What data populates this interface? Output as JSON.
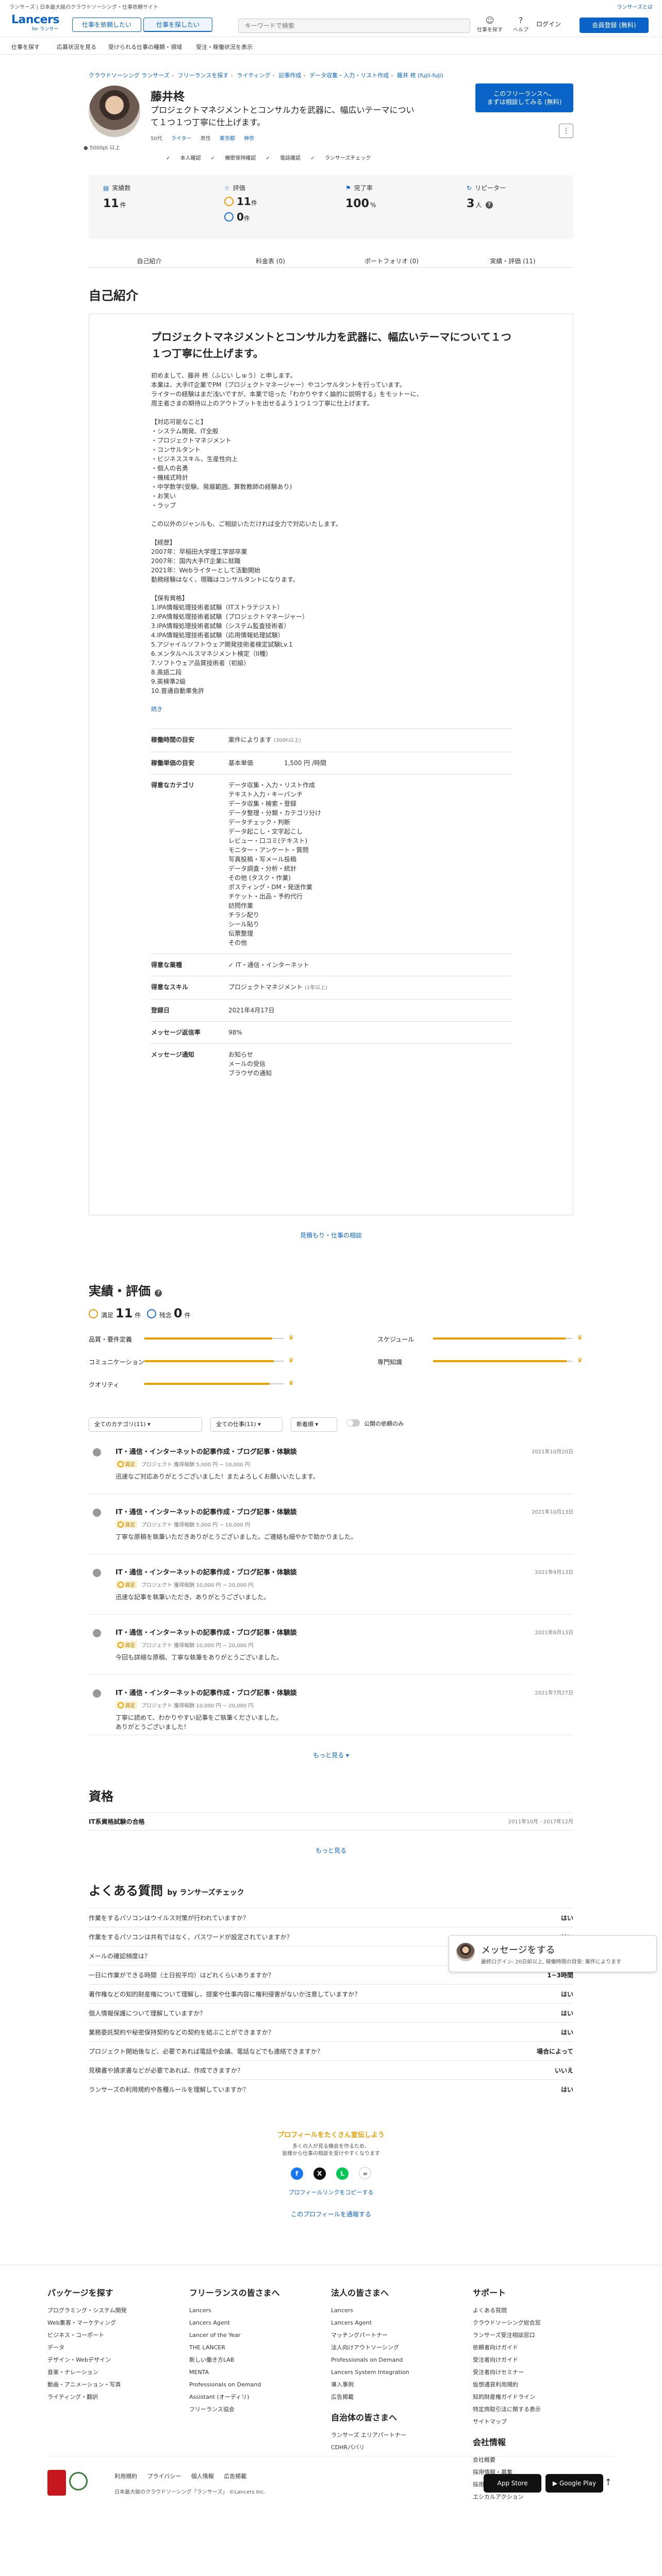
{
  "topbar": {
    "left": "ランサーズ | 日本最大級のクラウドソーシング・仕事依頼サイト",
    "right": "ランサーズとは"
  },
  "header": {
    "brand": "Lancers",
    "brand_sub": "for ランサー",
    "btn_request": "仕事を依頼したい",
    "btn_find": "仕事を探したい",
    "search_placeholder": "キーワードで検索",
    "icon_find": "仕事を探す",
    "icon_help": "ヘルプ",
    "login": "ログイン",
    "signup": "会員登録 (無料)"
  },
  "subnav": [
    "仕事を探す",
    "応募状況を見る",
    "受けられる仕事の種類・領域",
    "受注・稼働状況を表示"
  ],
  "breadcrumb": [
    "クラウドソーシング ランサーズ",
    "フリーランスを探す",
    "ライティング",
    "記事作成",
    "データ収集・入力・リスト作成",
    "藤井 柊 (fujii-fuji)"
  ],
  "profile": {
    "name": "藤井柊",
    "catch": "プロジェクトマネジメントとコンサル力を武器に、幅広いテーマについて１つ１つ丁寧に仕上げます。",
    "meta": [
      "50代",
      "ライター",
      "男性",
      "東京都",
      "神奈"
    ],
    "points": "● 5000pt 以上",
    "badges": [
      "本人確認",
      "機密保持確認",
      "電話確認",
      "ランサーズチェック"
    ],
    "consult": "このフリーランスへ、\nまずは相談してみる (無料)"
  },
  "stats": {
    "achievement_label": "実績数",
    "achievement": "11",
    "unit_ken": "件",
    "rating_label": "評価",
    "good": "11",
    "bad": "0",
    "completion_label": "完了率",
    "completion": "100",
    "unit_pct": "%",
    "repeat_label": "リピーター",
    "repeat": "3",
    "unit_nin": "人"
  },
  "tabs": [
    "自己紹介",
    "料金表 (0)",
    "ポートフォリオ (0)",
    "実績・評価 (11)"
  ],
  "intro": {
    "section": "自己紹介",
    "title": "プロジェクトマネジメントとコンサル力を武器に、幅広いテーマについて１つ１つ丁寧に仕上げます。",
    "body": "初めまして、藤井 柊（ふじい しゅう）と申します。\n本業は、大手IT企業でPM（プロジェクトマネージャー）やコンサルタントを行っています。\nライターの経験はまだ浅いですが、本業で培った「わかりやすく論的に説明する」をモットーに、\n周主者さまの期待以上のアウトプットを出せるよう１つ１つ丁寧に仕上げます。\n\n【対応可能なこと】\n・システム開発、IT全般\n・プロジェクトマネジメント\n・コンサルタント\n・ビジネススキル、生産性向上\n・個人の名勇\n・機械式時計\n・中学数学(受験、発展範囲、算数教師の経験あり)\n・お笑い\n・ラップ\n\nこの以外のジャンルも、ご相談いただければ全力で対応いたします。\n\n【経歴】\n2007年：早稲田大学理工学部卒業\n2007年：国内大手IT企業に就職\n2021年：Webライターとして活動開始\n勤務経験はなく、現職はコンサルタントになります。\n\n【保有資格】\n1.IPA情報処理技術者試験（ITストラテジスト）\n2.IPA情報処理技術者試験（プロジェクトマネージャー）\n3.IPA情報処理技術者試験（システム監査技術者）\n4.IPA情報処理技術者試験（応用情報処理試験）\n5.アジャイルソフトウェア開発技術者検定試験Lv.1\n6.メンタルヘルスマネジメント検定（II種）\n7.ソフトウェア品質技術者（初級）\n8.英語二段\n9.英検準2級\n10.普通自動車免許",
    "more": "続き",
    "rows": [
      {
        "k": "稼働時間の目安",
        "v": "案件によります",
        "note": "(300h以上)"
      },
      {
        "k": "稼働単価の目安",
        "v": "基本単価",
        "num": "1,500 円 /時間"
      },
      {
        "k": "得意なカテゴリ",
        "list": [
          "データ収集・入力・リスト作成",
          "テキスト入力・キーパンチ",
          "データ収集・検索・登録",
          "データ整理・分類・カテゴリ分け",
          "データチェック・判断",
          "データ起こし・文字起こし",
          "レビュー・口コミ(テキスト)",
          "モニター・アンケート・質問",
          "写真投稿・写メール投稿",
          "データ調査・分析・統計",
          "その他 (タスク・作業)",
          "ポスティング・DM・発送作業",
          "チケット・出品・予約代行",
          "訪問作業",
          "チラシ配り",
          "シール貼り",
          "伝票整理",
          "その他"
        ]
      },
      {
        "k": "得意な業種",
        "v": "IT・通信・インターネット"
      },
      {
        "k": "得意なスキル",
        "v": "プロジェクトマネジメント",
        "note": "(1年以上)"
      },
      {
        "k": "登録日",
        "v": "2021年4月17日"
      },
      {
        "k": "メッセージ返信率",
        "v": "98%"
      },
      {
        "k": "メッセージ通知",
        "list": [
          "お知らせ",
          "メールの受信",
          "ブラウザの通知"
        ]
      }
    ],
    "see_more": "見積もり・仕事の相談"
  },
  "reviews": {
    "section": "実績・評価",
    "good_label": "満足",
    "good": "11",
    "bad_label": "残念",
    "bad": "0",
    "unit": "件",
    "bars": [
      {
        "label": "品質・要件定義",
        "pct": 92
      },
      {
        "label": "スケジュール",
        "pct": 95
      },
      {
        "label": "コミュニケーション",
        "pct": 93
      },
      {
        "label": "専門知識",
        "pct": 96
      },
      {
        "label": "クオリティ",
        "pct": 90
      }
    ],
    "filter_category": "全てのカテゴリ(11)",
    "filter_type": "全ての仕事(11)",
    "filter_sort": "新着順",
    "toggle_label": "公開の依頼のみ",
    "items": [
      {
        "title": "IT・通信・インターネットの記事作成・ブログ記事・体験談",
        "date": "2021年10月20日",
        "meta": "プロジェクト  獲得報酬 5,000 円 ~ 10,000 円",
        "text": "迅速なご対応ありがとうございました！またよろしくお願いいたします。"
      },
      {
        "title": "IT・通信・インターネットの記事作成・ブログ記事・体験談",
        "date": "2021年10月13日",
        "meta": "プロジェクト  獲得報酬 5,000 円 ~ 10,000 円",
        "text": "丁寧な原稿を執筆いただきありがとうございました。ご連絡も細やかで助かりました。"
      },
      {
        "title": "IT・通信・インターネットの記事作成・ブログ記事・体験談",
        "date": "2021年9月13日",
        "meta": "プロジェクト  獲得報酬 10,000 円 ~ 20,000 円",
        "text": "迅速な記事を執筆いただき、ありがとうございました。"
      },
      {
        "title": "IT・通信・インターネットの記事作成・ブログ記事・体験談",
        "date": "2021年8月13日",
        "meta": "プロジェクト  獲得報酬 10,000 円 ~ 20,000 円",
        "text": "今回も詳細な原稿、丁寧な執筆をありがとうございました。"
      },
      {
        "title": "IT・通信・インターネットの記事作成・ブログ記事・体験談",
        "date": "2021年7月27日",
        "meta": "プロジェクト  獲得報酬 10,000 円 ~ 20,000 円",
        "text": "丁寧に読めて、わかりやすい記事をご執筆くださいました。\nありがとうございました！"
      }
    ],
    "good_chip": "満足",
    "more": "もっと見る"
  },
  "qualification": {
    "section": "資格",
    "title": "IT系資格試験の合格",
    "date": "2011年10月 - 2017年12月",
    "more": "もっと見る"
  },
  "faq": {
    "title": "よくある質問",
    "by": "by ランサーズチェック",
    "items": [
      {
        "q": "作業をするパソコンはウイルス対策が行われていますか？",
        "a": "はい"
      },
      {
        "q": "作業をするパソコンは共有ではなく、パスワードが設定されていますか？",
        "a": "はい"
      },
      {
        "q": "メールの確認頻度は？",
        "a": "毎日"
      },
      {
        "q": "一日に作業ができる時間（土日祝平均）はどれくらいありますか？",
        "a": "1~3時間"
      },
      {
        "q": "著作権などの知的財産権について理解し、提案や仕事内容に権利侵害がないか注意していますか？",
        "a": "はい"
      },
      {
        "q": "個人情報保護について理解していますか？",
        "a": "はい"
      },
      {
        "q": "業務委託契約や秘密保持契約などの契約を結ぶことができますか？",
        "a": "はい"
      },
      {
        "q": "プロジェクト開始後など、必要であれば電話や会議、電話などでも連絡できますか？",
        "a": "場合によって"
      },
      {
        "q": "見積書や請求書などが必要であれば、作成できますか？",
        "a": "いいえ"
      },
      {
        "q": "ランサーズの利用規約や各種ルールを理解していますか？",
        "a": "はい"
      }
    ]
  },
  "message": {
    "title": "メッセージをする",
    "sub": "最終ログイン: 20日前以上, 稼働時間の目安: 案件によります"
  },
  "share": {
    "line1": "プロフィールをたくさん宣伝しよう",
    "line2": "多くの人が見る機会を作るため、\n皆様から仕事の相談を受けやすくなります",
    "copy": "プロフィールリンクをコピーする",
    "report": "このプロフィールを通報する"
  },
  "footer": {
    "cols": [
      {
        "title": "パッケージを探す",
        "items": [
          "プログラミング・システム開発",
          "Web集客・マーケティング",
          "ビジネス・コーポート",
          "データ",
          "デザイン・Webデザイン",
          "音楽・ナレーション",
          "動画・アニメーション・写真",
          "ライティング・翻訳"
        ]
      },
      {
        "title": "フリーランスの皆さまへ",
        "items": [
          "Lancers",
          "Lancers Agent",
          "Lancer of the Year",
          "THE LANCER",
          "新しい働き方LAB",
          "MENTA",
          "Professionals on Demand",
          "Assistant (オーディリ)",
          "フリーランス協会"
        ]
      },
      {
        "title": "法人の皆さまへ",
        "items": [
          "Lancers",
          "Lancers Agent",
          "マッチングパートナー",
          "法人向けアウトソーシング",
          "Professionals on Demand",
          "Lancers System Integration",
          "導入事例",
          "広告掲載"
        ]
      },
      {
        "title": "サポート",
        "items": [
          "よくある質問",
          "クラウドソーシング総合窓",
          "ランサーズ受注相談窓口",
          "依頼者向けガイド",
          "受注者向けガイド",
          "受注者向けセミナー",
          "仮想通貨利用規約",
          "知的財産権ガイドライン",
          "特定商取引法に関する表示",
          "サイトマップ"
        ]
      }
    ],
    "extra_title": "自治体の皆さまへ",
    "extra_items": [
      "ランサーズ エリアパートナー",
      "CDHRパバリ"
    ],
    "company_title": "会社情報",
    "company_items": [
      "会社概要",
      "採用情報・募集",
      "採用情報・社員",
      "エシカルアクション"
    ],
    "links": [
      "利用規約",
      "プライバシー",
      "個人情報",
      "広告掲載"
    ],
    "copyright": "日本最大級のクラウドソーシング「ランサーズ」 ©Lancers Inc.",
    "appstore": "App Store",
    "googleplay": "Google Play",
    "top": "↑"
  }
}
